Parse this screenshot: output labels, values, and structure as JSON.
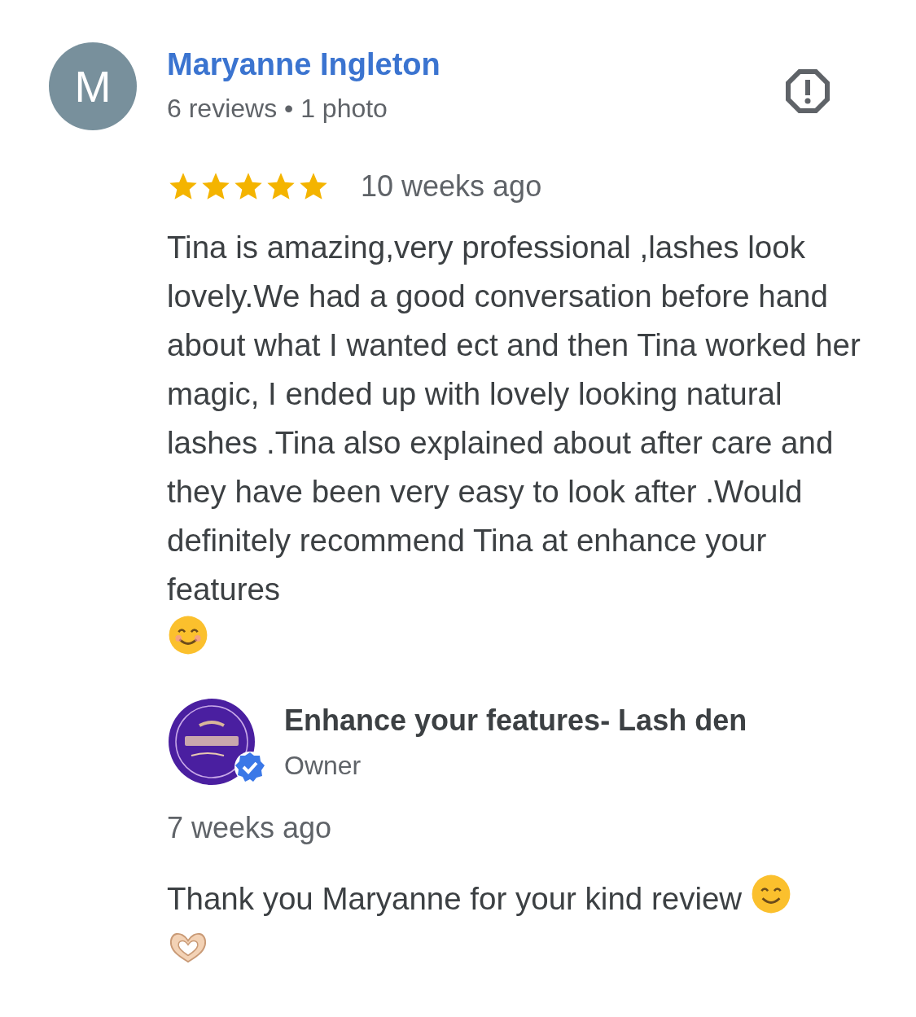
{
  "review": {
    "avatar_letter": "M",
    "author": "Maryanne Ingleton",
    "author_meta": "6 reviews • 1 photo",
    "stars": 5,
    "time": "10 weeks ago",
    "text": "Tina is amazing,very professional ,lashes look lovely.We had a good conversation before hand about what I wanted ect and then Tina worked her magic, I ended up with lovely looking natural lashes .Tina also explained about after care and they have been very easy to look after .Would definitely recommend Tina at enhance your features"
  },
  "owner_reply": {
    "avatar": {
      "kind": "picture",
      "verified": true
    },
    "name": "Enhance your features- Lash den",
    "role": "Owner",
    "time": "7 weeks ago",
    "text": "Thank you Maryanne for your kind review"
  }
}
